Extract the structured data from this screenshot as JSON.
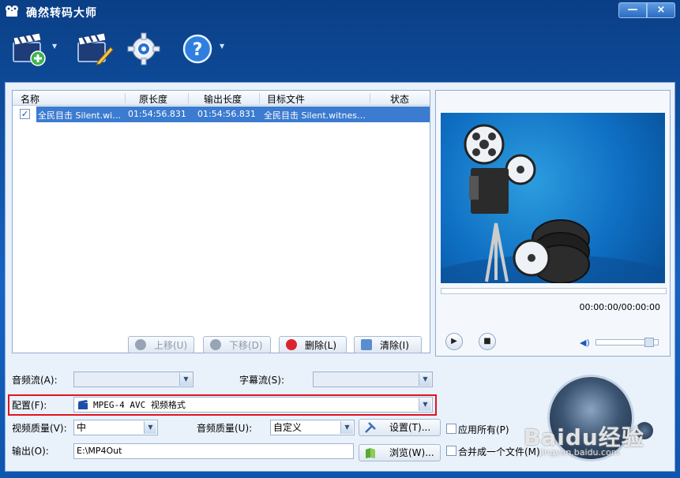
{
  "window": {
    "title": "确然转码大师",
    "minimize_label": "—",
    "close_label": "×"
  },
  "toolbar": {
    "buttons": [
      {
        "name": "add-file",
        "icon": "clapperboard-plus-icon",
        "has_dropdown": true
      },
      {
        "name": "edit",
        "icon": "clapperboard-pencil-icon",
        "has_dropdown": false
      },
      {
        "name": "settings",
        "icon": "gear-icon",
        "has_dropdown": false
      },
      {
        "name": "help",
        "icon": "help-icon",
        "has_dropdown": true
      }
    ],
    "help_label": "?"
  },
  "file_list": {
    "columns": [
      "名称",
      "原长度",
      "输出长度",
      "目标文件",
      "状态"
    ],
    "rows": [
      {
        "checked": true,
        "name": "全民目击 Silent.wi…",
        "original_length": "01:54:56.831",
        "output_length": "01:54:56.831",
        "target_file": "全民目击 Silent.witnes…",
        "status": ""
      }
    ],
    "buttons": {
      "move_up": "上移(U)",
      "move_down": "下移(D)",
      "delete": "删除(L)",
      "clear": "清除(I)"
    }
  },
  "preview": {
    "time": "00:00:00/00:00:00",
    "volume_level": 0.9
  },
  "settings": {
    "audio_stream_label": "音频流(A):",
    "audio_stream_value": "",
    "subtitle_stream_label": "字幕流(S):",
    "subtitle_stream_value": "",
    "profile_label": "配置(F):",
    "profile_value": "MPEG-4 AVC 视频格式",
    "video_quality_label": "视频质量(V):",
    "video_quality_value": "中",
    "audio_quality_label": "音频质量(U):",
    "audio_quality_value": "自定义",
    "settings_button": "设置(T)...",
    "output_label": "输出(O):",
    "output_value": "E:\\MP4Out",
    "browse_button": "浏览(W)...",
    "apply_all_label": "应用所有(P)",
    "apply_all_checked": false,
    "merge_label": "合并成一个文件(M)",
    "merge_checked": false
  },
  "watermark": {
    "text": "Baidu经验",
    "sub": "jingyan.baidu.com"
  },
  "colors": {
    "accent": "#3b7bd0",
    "highlight_box": "#e0141e"
  }
}
